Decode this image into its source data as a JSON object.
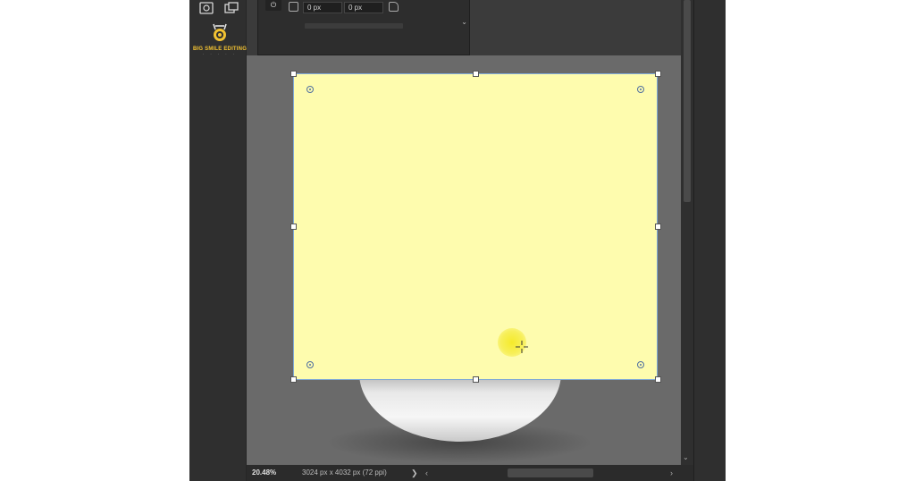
{
  "panel": {
    "x_offset": "0 px",
    "y_offset": "0 px"
  },
  "logo": {
    "brand": "BIG SMILE EDITING",
    "tagline": "· · · · ·",
    "accent": "#f2c232"
  },
  "shape": {
    "fill": "#fefcae",
    "border": "#7fa9d6"
  },
  "status": {
    "zoom": "20.48%",
    "document_size": "3024 px x 4032 px (72 ppi)",
    "chevron": "❯"
  },
  "scroll": {
    "left_arrow": "‹",
    "right_arrow": "›",
    "down_arrow": "⌄"
  }
}
